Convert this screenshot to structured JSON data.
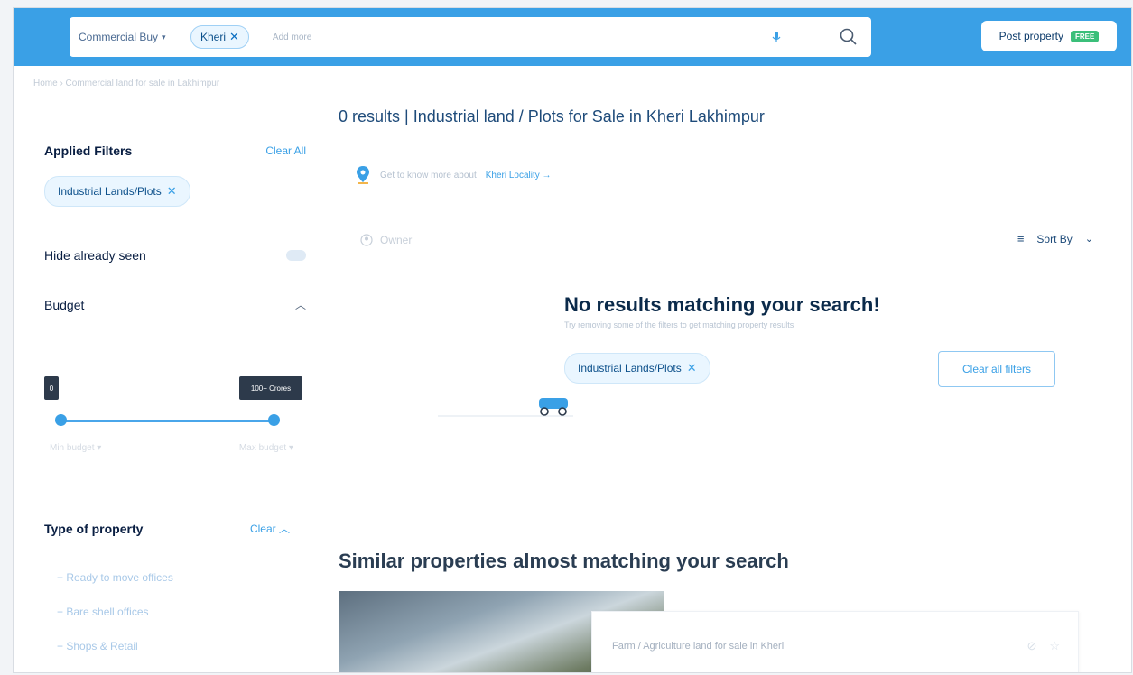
{
  "header": {
    "category": "Commercial Buy",
    "location_chip": "Kheri",
    "add_more_placeholder": "Add more",
    "post_property": "Post property",
    "free_badge": "FREE"
  },
  "breadcrumb": "Home › Commercial land for sale in Lakhimpur",
  "sidebar": {
    "applied_filters": "Applied Filters",
    "clear_all": "Clear All",
    "applied_chip": "Industrial Lands/Plots",
    "hide_seen": "Hide already seen",
    "budget": "Budget",
    "budget_min": "0",
    "budget_max": "100+ Crores",
    "min_budget": "Min budget",
    "max_budget": "Max budget",
    "type_of_property": "Type of property",
    "clear": "Clear",
    "types": [
      "+ Ready to move offices",
      "+ Bare shell offices",
      "+ Shops & Retail"
    ]
  },
  "main": {
    "results_title": "0 results | Industrial land / Plots for Sale in Kheri Lakhimpur",
    "locality_prefix": "Get to know more about",
    "locality_link": "Kheri Locality →",
    "owner": "Owner",
    "sort_by": "Sort By",
    "no_results_heading": "No results matching your search!",
    "no_results_sub": "Try removing some of the filters to get matching property results",
    "no_results_chip": "Industrial Lands/Plots",
    "clear_all_filters": "Clear all filters",
    "similar_heading": "Similar properties almost matching your search",
    "card_title": "Farm / Agriculture land for sale in Kheri"
  },
  "colors": {
    "brand_blue": "#3aa0e6",
    "dark_text": "#091e42",
    "free_green": "#3bbf7a"
  }
}
